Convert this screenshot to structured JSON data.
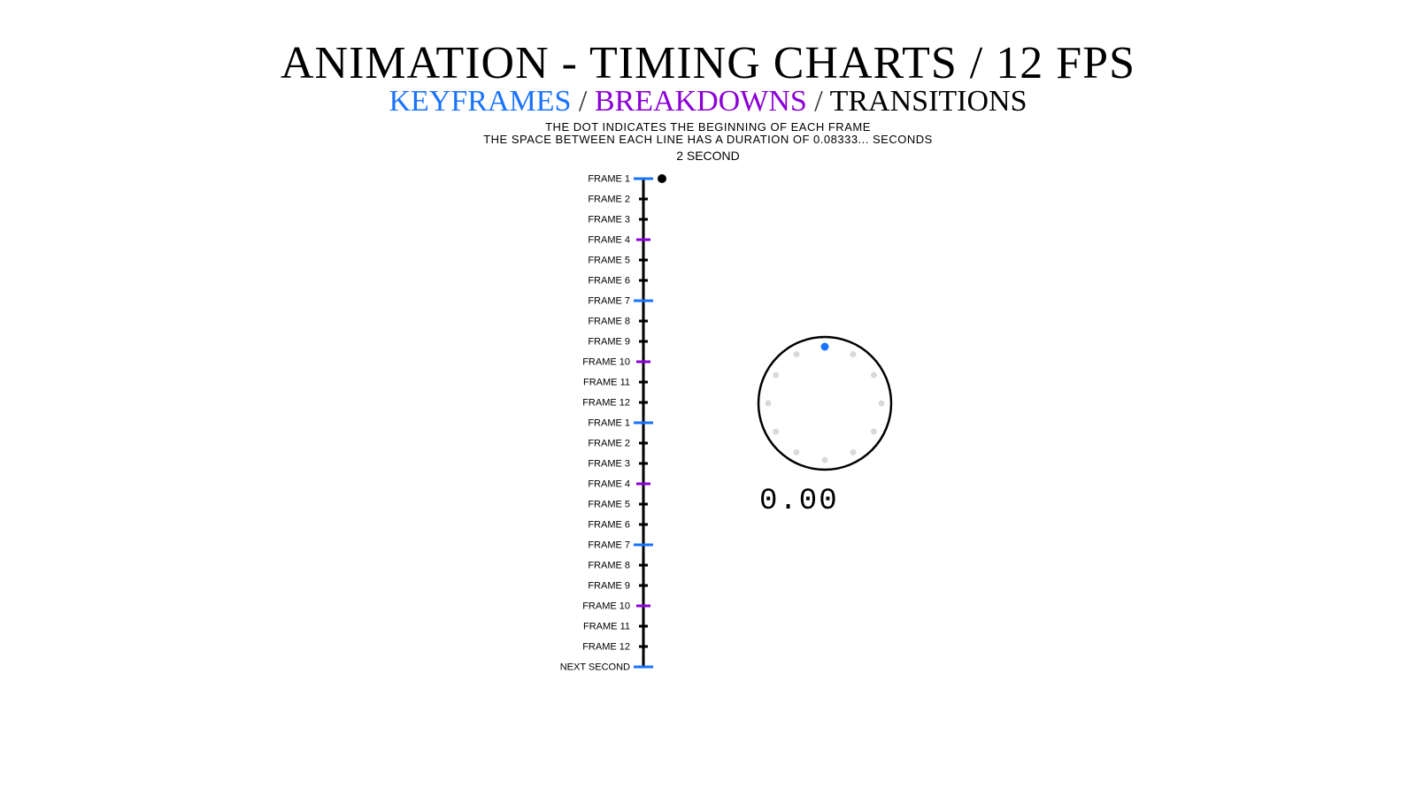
{
  "title": "ANIMATION - TIMING CHARTS / 12 FPS",
  "subtitle": {
    "keyframes": "KEYFRAMES",
    "breakdowns": "BREAKDOWNS",
    "transitions": "TRANSITIONS",
    "sep": " / "
  },
  "note1": "THE DOT INDICATES THE BEGINNING OF EACH FRAME",
  "note2": "THE SPACE BETWEEN EACH LINE HAS A DURATION OF 0.08333... SECONDS",
  "duration_label": "2 SECOND",
  "colors": {
    "keyframe": "#1a73ff",
    "breakdown": "#8b00d6",
    "transition": "#000000",
    "axis": "#000000",
    "dot": "#000000",
    "clock_dot_inactive": "#d9d9d9",
    "clock_dot_active": "#1a73ff"
  },
  "timing_chart": {
    "frames": [
      {
        "label": "FRAME 1",
        "type": "keyframe"
      },
      {
        "label": "FRAME 2",
        "type": "transition"
      },
      {
        "label": "FRAME 3",
        "type": "transition"
      },
      {
        "label": "FRAME 4",
        "type": "breakdown"
      },
      {
        "label": "FRAME 5",
        "type": "transition"
      },
      {
        "label": "FRAME 6",
        "type": "transition"
      },
      {
        "label": "FRAME 7",
        "type": "keyframe"
      },
      {
        "label": "FRAME 8",
        "type": "transition"
      },
      {
        "label": "FRAME 9",
        "type": "transition"
      },
      {
        "label": "FRAME 10",
        "type": "breakdown"
      },
      {
        "label": "FRAME 11",
        "type": "transition"
      },
      {
        "label": "FRAME 12",
        "type": "transition"
      },
      {
        "label": "FRAME 1",
        "type": "keyframe"
      },
      {
        "label": "FRAME 2",
        "type": "transition"
      },
      {
        "label": "FRAME 3",
        "type": "transition"
      },
      {
        "label": "FRAME 4",
        "type": "breakdown"
      },
      {
        "label": "FRAME 5",
        "type": "transition"
      },
      {
        "label": "FRAME 6",
        "type": "transition"
      },
      {
        "label": "FRAME 7",
        "type": "keyframe"
      },
      {
        "label": "FRAME 8",
        "type": "transition"
      },
      {
        "label": "FRAME 9",
        "type": "transition"
      },
      {
        "label": "FRAME 10",
        "type": "breakdown"
      },
      {
        "label": "FRAME 11",
        "type": "transition"
      },
      {
        "label": "FRAME 12",
        "type": "transition"
      },
      {
        "label": "NEXT SECOND",
        "type": "keyframe"
      }
    ],
    "dot_frame_index": 0
  },
  "clock": {
    "active_index": 0,
    "dot_count": 12
  },
  "counter": "0.00"
}
